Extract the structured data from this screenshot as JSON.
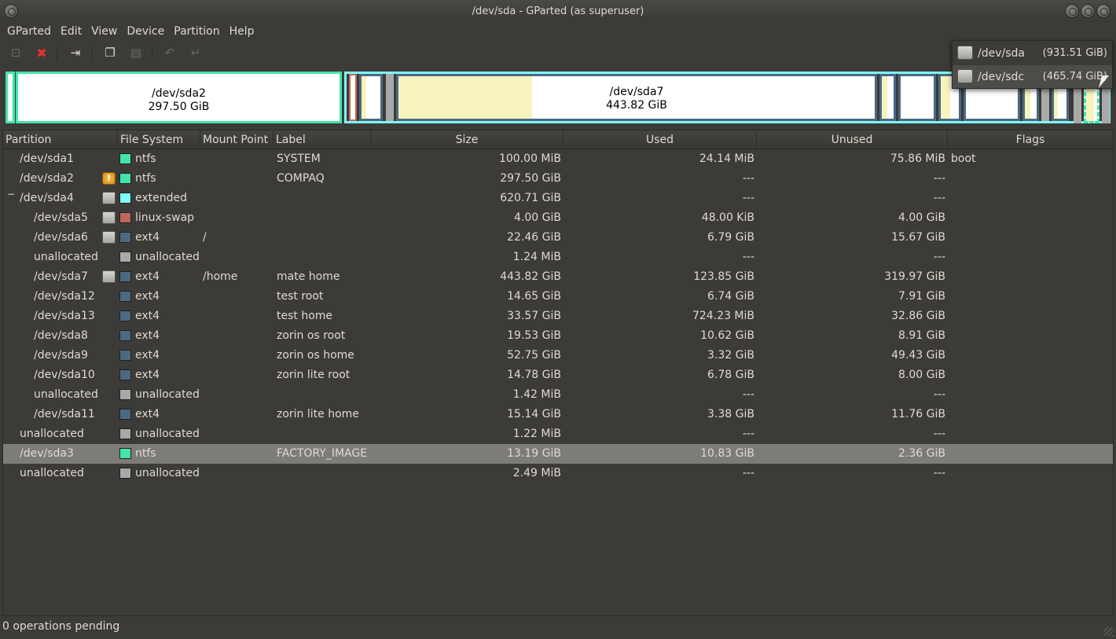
{
  "window": {
    "title": "/dev/sda - GParted (as superuser)"
  },
  "menu": [
    "GParted",
    "Edit",
    "View",
    "Device",
    "Partition",
    "Help"
  ],
  "devices": [
    {
      "name": "/dev/sda",
      "size": "(931.51 GiB)"
    },
    {
      "name": "/dev/sdc",
      "size": "(465.74 GiB)"
    }
  ],
  "diskmap": {
    "sda2": {
      "name": "/dev/sda2",
      "size": "297.50 GiB"
    },
    "sda7": {
      "name": "/dev/sda7",
      "size": "443.82 GiB"
    }
  },
  "colors": {
    "ntfs": "#42e5ac",
    "extended": "#7dfcfe",
    "linux-swap": "#c1665a",
    "ext4": "#4b6983",
    "unallocated": "#a9a9a9",
    "used": "#f7f3bc"
  },
  "columns": [
    "Partition",
    "File System",
    "Mount Point",
    "Label",
    "Size",
    "Used",
    "Unused",
    "Flags"
  ],
  "rows": [
    {
      "partition": "/dev/sda1",
      "fs": "ntfs",
      "mount": "",
      "label": "SYSTEM",
      "size": "100.00 MiB",
      "used": "24.14 MiB",
      "unused": "75.86 MiB",
      "flags": "boot"
    },
    {
      "partition": "/dev/sda2",
      "fs": "ntfs",
      "mount": "",
      "label": "COMPAQ",
      "size": "297.50 GiB",
      "used": "---",
      "unused": "---",
      "flags": ""
    },
    {
      "partition": "/dev/sda4",
      "fs": "extended",
      "mount": "",
      "label": "",
      "size": "620.71 GiB",
      "used": "---",
      "unused": "---",
      "flags": ""
    },
    {
      "partition": "/dev/sda5",
      "fs": "linux-swap",
      "mount": "",
      "label": "",
      "size": "4.00 GiB",
      "used": "48.00 KiB",
      "unused": "4.00 GiB",
      "flags": ""
    },
    {
      "partition": "/dev/sda6",
      "fs": "ext4",
      "mount": "/",
      "label": "",
      "size": "22.46 GiB",
      "used": "6.79 GiB",
      "unused": "15.67 GiB",
      "flags": ""
    },
    {
      "partition": "unallocated",
      "fs": "unallocated",
      "mount": "",
      "label": "",
      "size": "1.24 MiB",
      "used": "---",
      "unused": "---",
      "flags": ""
    },
    {
      "partition": "/dev/sda7",
      "fs": "ext4",
      "mount": "/home",
      "label": "mate home",
      "size": "443.82 GiB",
      "used": "123.85 GiB",
      "unused": "319.97 GiB",
      "flags": ""
    },
    {
      "partition": "/dev/sda12",
      "fs": "ext4",
      "mount": "",
      "label": "test root",
      "size": "14.65 GiB",
      "used": "6.74 GiB",
      "unused": "7.91 GiB",
      "flags": ""
    },
    {
      "partition": "/dev/sda13",
      "fs": "ext4",
      "mount": "",
      "label": "test home",
      "size": "33.57 GiB",
      "used": "724.23 MiB",
      "unused": "32.86 GiB",
      "flags": ""
    },
    {
      "partition": "/dev/sda8",
      "fs": "ext4",
      "mount": "",
      "label": "zorin os root",
      "size": "19.53 GiB",
      "used": "10.62 GiB",
      "unused": "8.91 GiB",
      "flags": ""
    },
    {
      "partition": "/dev/sda9",
      "fs": "ext4",
      "mount": "",
      "label": "zorin os home",
      "size": "52.75 GiB",
      "used": "3.32 GiB",
      "unused": "49.43 GiB",
      "flags": ""
    },
    {
      "partition": "/dev/sda10",
      "fs": "ext4",
      "mount": "",
      "label": "zorin lite root",
      "size": "14.78 GiB",
      "used": "6.78 GiB",
      "unused": "8.00 GiB",
      "flags": ""
    },
    {
      "partition": "unallocated",
      "fs": "unallocated",
      "mount": "",
      "label": "",
      "size": "1.42 MiB",
      "used": "---",
      "unused": "---",
      "flags": ""
    },
    {
      "partition": "/dev/sda11",
      "fs": "ext4",
      "mount": "",
      "label": "zorin lite home",
      "size": "15.14 GiB",
      "used": "3.38 GiB",
      "unused": "11.76 GiB",
      "flags": ""
    },
    {
      "partition": "unallocated",
      "fs": "unallocated",
      "mount": "",
      "label": "",
      "size": "1.22 MiB",
      "used": "---",
      "unused": "---",
      "flags": ""
    },
    {
      "partition": "/dev/sda3",
      "fs": "ntfs",
      "mount": "",
      "label": "FACTORY_IMAGE",
      "size": "13.19 GiB",
      "used": "10.83 GiB",
      "unused": "2.36 GiB",
      "flags": ""
    },
    {
      "partition": "unallocated",
      "fs": "unallocated",
      "mount": "",
      "label": "",
      "size": "2.49 MiB",
      "used": "---",
      "unused": "---",
      "flags": ""
    }
  ],
  "status": {
    "text": "0 operations pending"
  }
}
